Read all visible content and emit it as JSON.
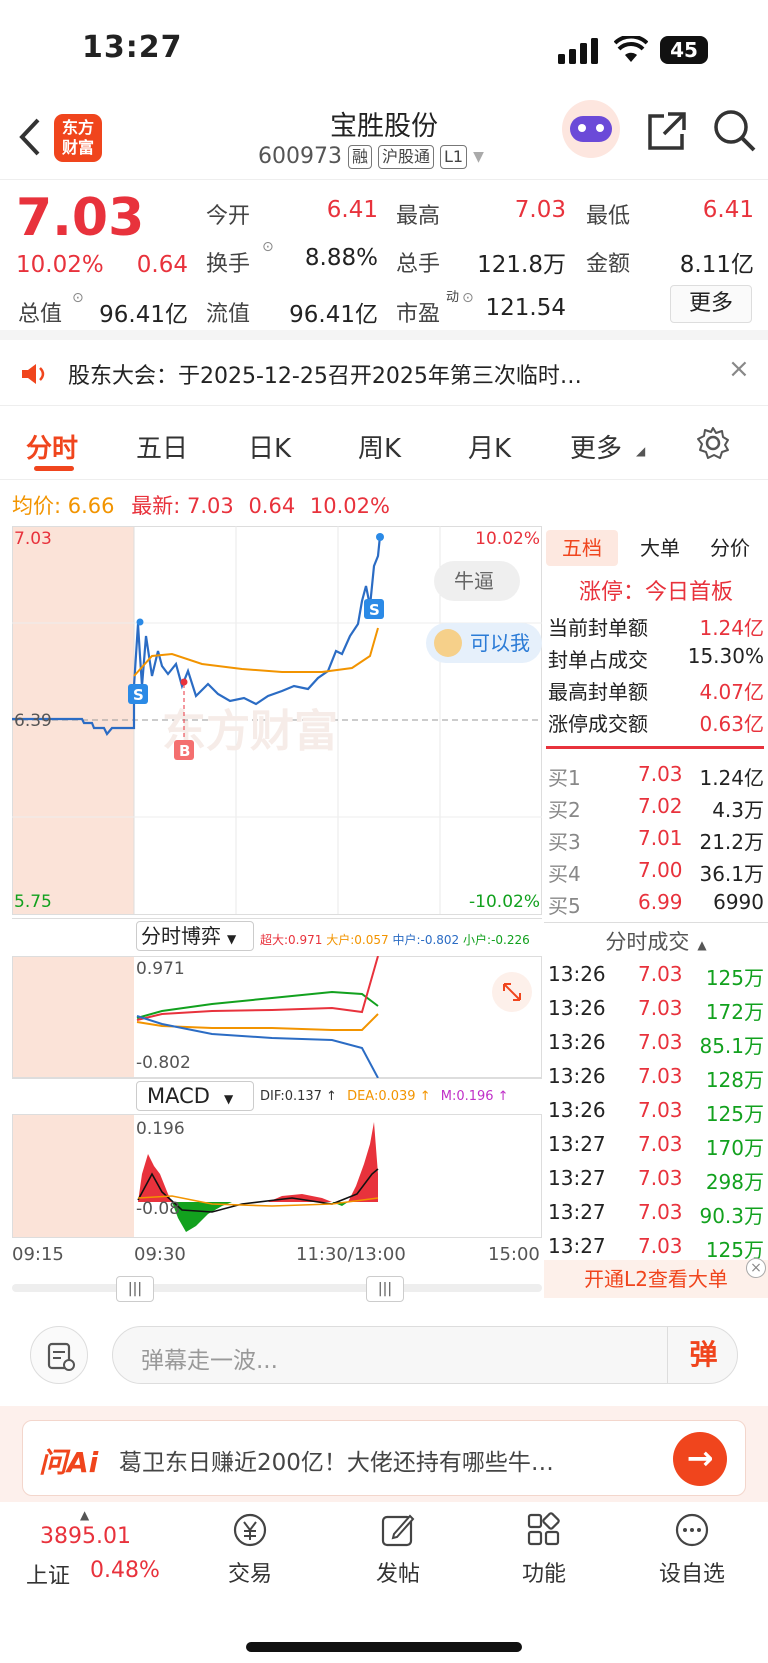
{
  "status": {
    "time": "13:27",
    "battery": "45"
  },
  "header": {
    "logo_line1": "东方",
    "logo_line2": "财富",
    "name": "宝胜股份",
    "code": "600973",
    "tags": [
      "融",
      "沪股通",
      "L1"
    ]
  },
  "quote": {
    "price": "7.03",
    "change_pct": "10.02%",
    "change": "0.64",
    "fields": {
      "open_l": "今开",
      "open_v": "6.41",
      "high_l": "最高",
      "high_v": "7.03",
      "low_l": "最低",
      "low_v": "6.41",
      "turnover_l": "换手",
      "turnover_v": "8.88%",
      "volume_l": "总手",
      "volume_v": "121.8万",
      "amount_l": "金额",
      "amount_v": "8.11亿",
      "mcap_l": "总值",
      "mcap_v": "96.41亿",
      "float_l": "流值",
      "float_v": "96.41亿",
      "pe_l": "市盈",
      "pe_sup": "动",
      "pe_v": "121.54"
    },
    "more": "更多"
  },
  "notice": {
    "text": "股东大会：于2025-12-25召开2025年第三次临时…"
  },
  "tabs": [
    "分时",
    "五日",
    "日K",
    "周K",
    "月K",
    "更多"
  ],
  "chart": {
    "avg_label": "均价:",
    "avg_value": "6.66",
    "latest_label": "最新:",
    "latest_value": "7.03",
    "latest_change": "0.64",
    "latest_pct": "10.02%",
    "top_price": "7.03",
    "mid_price": "6.39",
    "bottom_price": "5.75",
    "top_pct": "10.02%",
    "bottom_pct": "-10.02%",
    "bubble1": "牛逼",
    "bubble2": "可以我",
    "marker_s": "S",
    "marker_b": "B",
    "watermark": "东方财富",
    "times": [
      "09:15",
      "09:30",
      "11:30/13:00",
      "15:00"
    ]
  },
  "game": {
    "title": "分时博弈",
    "big_l": "超大:0.971",
    "large_l": "大户:0.057",
    "mid_l": "中户:-0.802",
    "small_l": "小户:-0.226",
    "max": "0.971",
    "min": "-0.802"
  },
  "macd": {
    "title": "MACD",
    "dif": "DIF:0.137 ↑",
    "dea": "DEA:0.039 ↑",
    "m": "M:0.196 ↑",
    "max": "0.196",
    "min": "-0.08"
  },
  "orderbook": {
    "tabs": [
      "五档",
      "大单",
      "分价"
    ],
    "limit_title": "涨停：今日首板",
    "stats": [
      {
        "label": "当前封单额",
        "value": "1.24亿"
      },
      {
        "label": "封单占成交",
        "value": "15.30%"
      },
      {
        "label": "最高封单额",
        "value": "4.07亿"
      },
      {
        "label": "涨停成交额",
        "value": "0.63亿"
      }
    ],
    "bids": [
      {
        "label": "买1",
        "price": "7.03",
        "vol": "1.24亿"
      },
      {
        "label": "买2",
        "price": "7.02",
        "vol": "4.3万"
      },
      {
        "label": "买3",
        "price": "7.01",
        "vol": "21.2万"
      },
      {
        "label": "买4",
        "price": "7.00",
        "vol": "36.1万"
      },
      {
        "label": "买5",
        "price": "6.99",
        "vol": "6990"
      }
    ],
    "ticks_title": "分时成交",
    "ticks": [
      {
        "t": "13:26",
        "p": "7.03",
        "v": "125万"
      },
      {
        "t": "13:26",
        "p": "7.03",
        "v": "172万"
      },
      {
        "t": "13:26",
        "p": "7.03",
        "v": "85.1万"
      },
      {
        "t": "13:26",
        "p": "7.03",
        "v": "128万"
      },
      {
        "t": "13:26",
        "p": "7.03",
        "v": "125万"
      },
      {
        "t": "13:27",
        "p": "7.03",
        "v": "170万"
      },
      {
        "t": "13:27",
        "p": "7.03",
        "v": "298万"
      },
      {
        "t": "13:27",
        "p": "7.03",
        "v": "90.3万"
      },
      {
        "t": "13:27",
        "p": "7.03",
        "v": "125万"
      }
    ],
    "l2": "开通L2查看大单"
  },
  "comment": {
    "placeholder": "弹幕走一波...",
    "btn": "弹"
  },
  "ai": {
    "logo": "问Ai",
    "text": "葛卫东日赚近200亿！大佬还持有哪些牛…"
  },
  "tabbar": {
    "index_value": "3895.01",
    "index_name": "上证",
    "index_pct": "0.48%",
    "trade": "交易",
    "post": "发帖",
    "func": "功能",
    "fav": "设自选"
  },
  "colors": {
    "up": "#e8323c",
    "down": "#12a11e",
    "avg": "#f29400",
    "accent": "#f0451d"
  }
}
